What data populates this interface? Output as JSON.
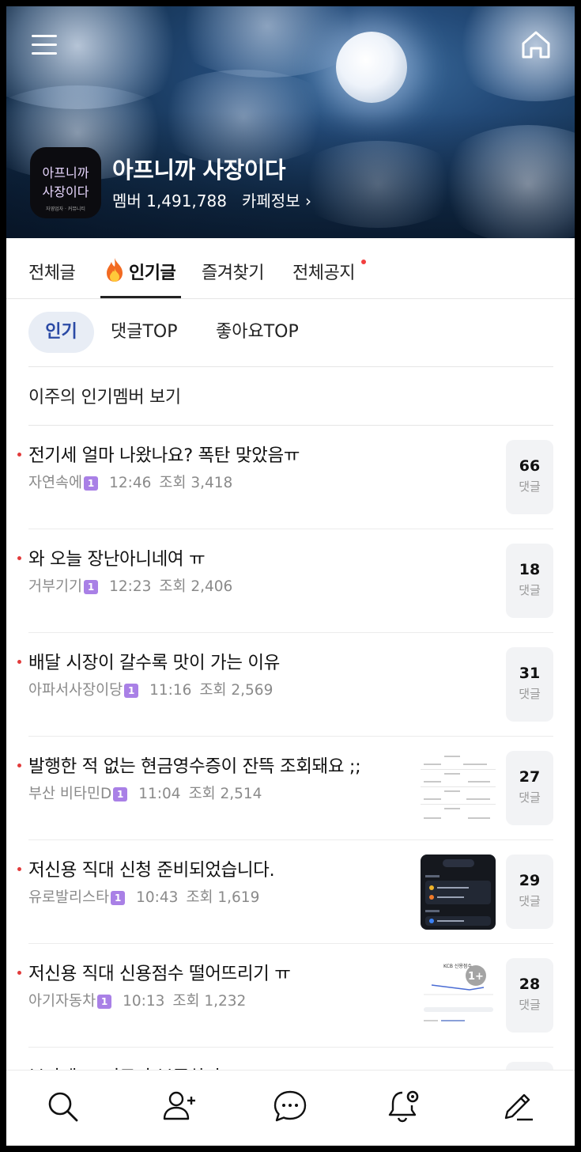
{
  "cafe": {
    "name": "아프니까 사장이다",
    "members": "멤버 1,491,788",
    "info_link": "카페정보",
    "logo_text_top": "아프니까",
    "logo_text_bottom": "사장이다",
    "logo_sub": "자영업자 · 커뮤니티"
  },
  "tabs": {
    "all": "전체글",
    "popular": "인기글",
    "favorites": "즐겨찾기",
    "notices": "전체공지"
  },
  "subtabs": {
    "popular": "인기",
    "comments_top": "댓글TOP",
    "likes_top": "좋아요TOP"
  },
  "weekly_members": "이주의 인기멤버 보기",
  "posts": [
    {
      "title": "전기세 얼마 나왔나요? 폭탄 맞았음ㅠ",
      "author": "자연속에",
      "level": "1",
      "time": "12:46",
      "views": "조회 3,418",
      "comments": "66",
      "comment_label": "댓글"
    },
    {
      "title": "와 오늘 장난아니네여 ㅠ",
      "author": "거부기기",
      "level": "1",
      "time": "12:23",
      "views": "조회 2,406",
      "comments": "18",
      "comment_label": "댓글"
    },
    {
      "title": "배달 시장이 갈수록 맛이 가는 이유",
      "author": "아파서사장이당",
      "level": "1",
      "time": "11:16",
      "views": "조회 2,569",
      "comments": "31",
      "comment_label": "댓글"
    },
    {
      "title": "발행한 적 없는 현금영수증이 잔뜩 조회돼요 ;;",
      "author": "부산 비타민D",
      "level": "1",
      "time": "11:04",
      "views": "조회 2,514",
      "comments": "27",
      "comment_label": "댓글"
    },
    {
      "title": "저신용 직대 신청 준비되었습니다.",
      "author": "유로발리스타",
      "level": "1",
      "time": "10:43",
      "views": "조회 1,619",
      "comments": "29",
      "comment_label": "댓글"
    },
    {
      "title": "저신용 직대 신용점수 떨어뜨리기 ㅠ",
      "author": "아기자동차",
      "level": "1",
      "time": "10:13",
      "views": "조회 1,232",
      "comments": "28",
      "comment_label": "댓글"
    },
    {
      "title": "부가세 ... 지로가 부족하다고",
      "author": "",
      "level": "",
      "time": "",
      "views": "",
      "comments": "",
      "comment_label": ""
    }
  ],
  "thumb_badge": "1+",
  "thumb_chart_title": "KCB 신용점수",
  "icons": {
    "menu": "hamburger-icon",
    "home": "home-icon",
    "search": "search-icon",
    "add_member": "add-user-icon",
    "chat": "chat-icon",
    "notification_settings": "bell-settings-icon",
    "write": "pencil-icon"
  },
  "colors": {
    "new_dot": "#e23b3b",
    "level_badge": "#a980e6",
    "active_subtab_bg": "#e8edf5",
    "active_subtab_text": "#2b4aa5"
  }
}
